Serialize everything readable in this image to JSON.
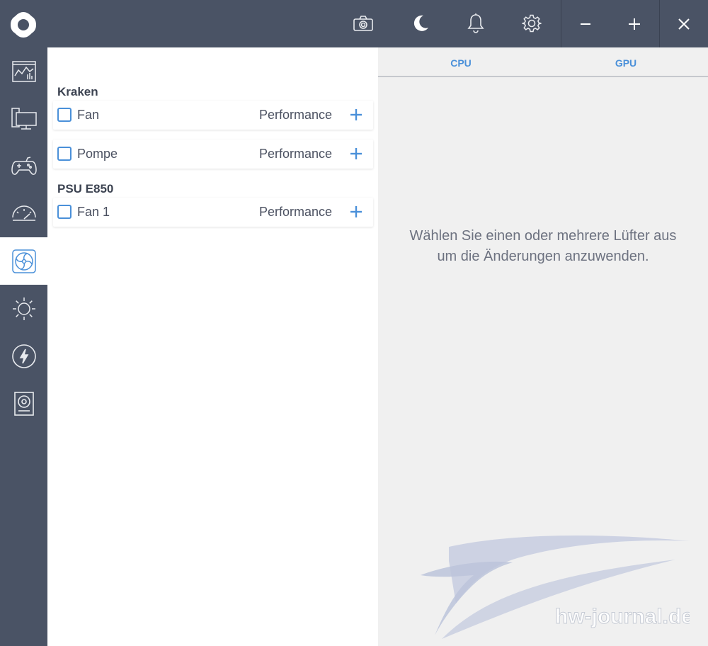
{
  "topbar": {
    "icons": [
      "camera-icon",
      "moon-icon",
      "bell-icon",
      "gear-icon"
    ],
    "window_controls": [
      "minimize-icon",
      "maximize-icon",
      "close-icon"
    ]
  },
  "sidebar": {
    "items": [
      {
        "icon": "dashboard-chart-icon",
        "active": false
      },
      {
        "icon": "pc-monitor-icon",
        "active": false
      },
      {
        "icon": "gamepad-icon",
        "active": false
      },
      {
        "icon": "speedometer-icon",
        "active": false
      },
      {
        "icon": "fan-icon",
        "active": true
      },
      {
        "icon": "sun-lighting-icon",
        "active": false
      },
      {
        "icon": "lightning-power-icon",
        "active": false
      },
      {
        "icon": "audio-speaker-icon",
        "active": false
      }
    ]
  },
  "groups": [
    {
      "title": "Kraken",
      "devices": [
        {
          "name": "Fan",
          "profile": "Performance"
        },
        {
          "name": "Pompe",
          "profile": "Performance"
        }
      ]
    },
    {
      "title": "PSU E850",
      "devices": [
        {
          "name": "Fan 1",
          "profile": "Performance"
        }
      ]
    }
  ],
  "right_panel": {
    "tabs": [
      "CPU",
      "GPU"
    ],
    "hint": "Wählen Sie einen oder mehrere Lüfter aus um die Änderungen anzuwenden.",
    "watermark": "hw-journal.de"
  },
  "colors": {
    "chrome": "#4a5365",
    "accent": "#4a90d9",
    "panel_bg": "#f0f0f0"
  }
}
